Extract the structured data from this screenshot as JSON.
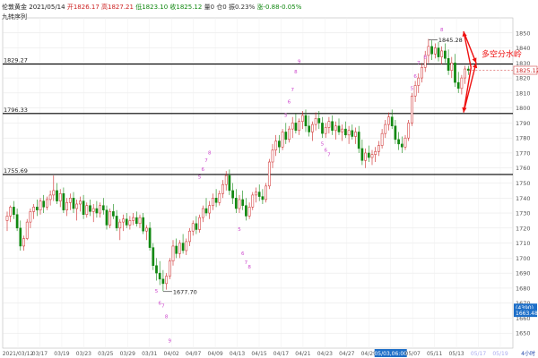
{
  "header": {
    "instrument": "伦敦黄金",
    "date": "2021/05/14",
    "open_label": "开",
    "open": "1826.17",
    "high_label": "高",
    "high": "1827.21",
    "low_label": "低",
    "low": "1823.10",
    "close_label": "收",
    "close": "1825.12",
    "volume_label": "量",
    "volume": "0",
    "oi_label": "仓",
    "oi": "0",
    "amplitude_label": "振",
    "amplitude": "0.23%",
    "change_label": "涨",
    "change": "-0.88",
    "change_pct": "-0.05%",
    "indicator": "九转序列"
  },
  "colors": {
    "up": "#cc2222",
    "down": "#118811",
    "level_line": "#000000",
    "grid": "#e3e3e3",
    "axis_text": "#555555",
    "td_up": "#cc44cc",
    "td_down": "#22aa22",
    "arrow": "#ee1111",
    "price_tag_bg": "#1e6fc8"
  },
  "chart_data": {
    "type": "candlestick",
    "title": "伦敦黄金 2021/05/14",
    "ylim": [
      1640,
      1860
    ],
    "y_ticks": [
      1650,
      1660,
      1670,
      1680,
      1690,
      1700,
      1710,
      1720,
      1730,
      1740,
      1750,
      1760,
      1770,
      1780,
      1790,
      1800,
      1810,
      1820,
      1830,
      1840,
      1850
    ],
    "x_ticks": [
      "2021/03/12",
      "03/17",
      "03/19",
      "03/23",
      "03/25",
      "03/29",
      "03/31",
      "04/02",
      "04/07",
      "04/09",
      "04/13",
      "04/15",
      "04/17",
      "04/21",
      "04/23",
      "04/27",
      "04/29",
      "05/03,06:00",
      "05/07",
      "05/11",
      "05/13",
      "05/17",
      "05/19"
    ],
    "x_ticks_future": [
      "05/17",
      "05/19"
    ],
    "x_tick_highlight": "05/03,06:00",
    "right_tags": [
      {
        "text": "(4390)",
        "value": 1667
      },
      {
        "text": "1663.48",
        "value": 1663.48
      }
    ],
    "level_lines": [
      {
        "value": 1829.27,
        "label": "1829.27"
      },
      {
        "value": 1796.33,
        "label": "1796.33"
      },
      {
        "value": 1755.69,
        "label": "1755.69"
      }
    ],
    "annotations": [
      {
        "text": "1845.28",
        "value": 1845.28,
        "kind": "high"
      },
      {
        "text": "1677.70",
        "value": 1677.7,
        "kind": "low"
      },
      {
        "text": "多空分水岭",
        "kind": "callout"
      }
    ],
    "current_price": "1825.12",
    "bottom_right_text": "4小时",
    "forecast": {
      "start": 1827,
      "up_target": 1851,
      "down_target": 1797,
      "ends": [
        1830,
        1830
      ]
    },
    "candles": [
      {
        "o": 1725,
        "h": 1731,
        "l": 1718,
        "c": 1728
      },
      {
        "o": 1728,
        "h": 1735,
        "l": 1724,
        "c": 1734
      },
      {
        "o": 1734,
        "h": 1738,
        "l": 1726,
        "c": 1729
      },
      {
        "o": 1729,
        "h": 1733,
        "l": 1718,
        "c": 1720
      },
      {
        "o": 1720,
        "h": 1725,
        "l": 1705,
        "c": 1708
      },
      {
        "o": 1708,
        "h": 1715,
        "l": 1705,
        "c": 1713
      },
      {
        "o": 1713,
        "h": 1726,
        "l": 1712,
        "c": 1724
      },
      {
        "o": 1724,
        "h": 1733,
        "l": 1720,
        "c": 1731
      },
      {
        "o": 1731,
        "h": 1736,
        "l": 1726,
        "c": 1734
      },
      {
        "o": 1734,
        "h": 1739,
        "l": 1728,
        "c": 1732
      },
      {
        "o": 1732,
        "h": 1740,
        "l": 1729,
        "c": 1738
      },
      {
        "o": 1738,
        "h": 1742,
        "l": 1730,
        "c": 1734
      },
      {
        "o": 1734,
        "h": 1741,
        "l": 1732,
        "c": 1739
      },
      {
        "o": 1739,
        "h": 1745,
        "l": 1735,
        "c": 1742
      },
      {
        "o": 1742,
        "h": 1755,
        "l": 1738,
        "c": 1745
      },
      {
        "o": 1745,
        "h": 1750,
        "l": 1736,
        "c": 1738
      },
      {
        "o": 1738,
        "h": 1746,
        "l": 1734,
        "c": 1743
      },
      {
        "o": 1743,
        "h": 1747,
        "l": 1730,
        "c": 1732
      },
      {
        "o": 1732,
        "h": 1740,
        "l": 1728,
        "c": 1737
      },
      {
        "o": 1737,
        "h": 1743,
        "l": 1732,
        "c": 1740
      },
      {
        "o": 1740,
        "h": 1744,
        "l": 1730,
        "c": 1733
      },
      {
        "o": 1733,
        "h": 1739,
        "l": 1725,
        "c": 1736
      },
      {
        "o": 1736,
        "h": 1741,
        "l": 1731,
        "c": 1738
      },
      {
        "o": 1738,
        "h": 1742,
        "l": 1726,
        "c": 1729
      },
      {
        "o": 1729,
        "h": 1737,
        "l": 1727,
        "c": 1735
      },
      {
        "o": 1735,
        "h": 1739,
        "l": 1728,
        "c": 1731
      },
      {
        "o": 1731,
        "h": 1736,
        "l": 1724,
        "c": 1733
      },
      {
        "o": 1733,
        "h": 1738,
        "l": 1727,
        "c": 1730
      },
      {
        "o": 1730,
        "h": 1737,
        "l": 1727,
        "c": 1735
      },
      {
        "o": 1735,
        "h": 1740,
        "l": 1729,
        "c": 1732
      },
      {
        "o": 1732,
        "h": 1735,
        "l": 1719,
        "c": 1722
      },
      {
        "o": 1722,
        "h": 1733,
        "l": 1720,
        "c": 1731
      },
      {
        "o": 1731,
        "h": 1736,
        "l": 1726,
        "c": 1728
      },
      {
        "o": 1728,
        "h": 1732,
        "l": 1718,
        "c": 1720
      },
      {
        "o": 1720,
        "h": 1726,
        "l": 1712,
        "c": 1724
      },
      {
        "o": 1724,
        "h": 1729,
        "l": 1718,
        "c": 1726
      },
      {
        "o": 1726,
        "h": 1730,
        "l": 1720,
        "c": 1722
      },
      {
        "o": 1722,
        "h": 1728,
        "l": 1719,
        "c": 1725
      },
      {
        "o": 1725,
        "h": 1730,
        "l": 1722,
        "c": 1727
      },
      {
        "o": 1727,
        "h": 1731,
        "l": 1721,
        "c": 1723
      },
      {
        "o": 1723,
        "h": 1729,
        "l": 1720,
        "c": 1727
      },
      {
        "o": 1727,
        "h": 1730,
        "l": 1716,
        "c": 1718
      },
      {
        "o": 1718,
        "h": 1722,
        "l": 1712,
        "c": 1720
      },
      {
        "o": 1720,
        "h": 1724,
        "l": 1705,
        "c": 1707
      },
      {
        "o": 1707,
        "h": 1710,
        "l": 1692,
        "c": 1695
      },
      {
        "o": 1695,
        "h": 1700,
        "l": 1685,
        "c": 1690
      },
      {
        "o": 1690,
        "h": 1698,
        "l": 1682,
        "c": 1686
      },
      {
        "o": 1686,
        "h": 1692,
        "l": 1678,
        "c": 1683
      },
      {
        "o": 1683,
        "h": 1690,
        "l": 1679,
        "c": 1688
      },
      {
        "o": 1688,
        "h": 1700,
        "l": 1686,
        "c": 1698
      },
      {
        "o": 1698,
        "h": 1712,
        "l": 1695,
        "c": 1708
      },
      {
        "o": 1708,
        "h": 1713,
        "l": 1700,
        "c": 1703
      },
      {
        "o": 1703,
        "h": 1712,
        "l": 1700,
        "c": 1710
      },
      {
        "o": 1710,
        "h": 1716,
        "l": 1703,
        "c": 1705
      },
      {
        "o": 1705,
        "h": 1713,
        "l": 1702,
        "c": 1711
      },
      {
        "o": 1711,
        "h": 1720,
        "l": 1708,
        "c": 1718
      },
      {
        "o": 1718,
        "h": 1725,
        "l": 1715,
        "c": 1723
      },
      {
        "o": 1723,
        "h": 1728,
        "l": 1716,
        "c": 1719
      },
      {
        "o": 1719,
        "h": 1729,
        "l": 1717,
        "c": 1727
      },
      {
        "o": 1727,
        "h": 1735,
        "l": 1724,
        "c": 1733
      },
      {
        "o": 1733,
        "h": 1740,
        "l": 1728,
        "c": 1730
      },
      {
        "o": 1730,
        "h": 1738,
        "l": 1726,
        "c": 1735
      },
      {
        "o": 1735,
        "h": 1743,
        "l": 1732,
        "c": 1740
      },
      {
        "o": 1740,
        "h": 1746,
        "l": 1734,
        "c": 1737
      },
      {
        "o": 1737,
        "h": 1745,
        "l": 1735,
        "c": 1743
      },
      {
        "o": 1743,
        "h": 1752,
        "l": 1740,
        "c": 1749
      },
      {
        "o": 1749,
        "h": 1758,
        "l": 1745,
        "c": 1755
      },
      {
        "o": 1755,
        "h": 1759,
        "l": 1742,
        "c": 1745
      },
      {
        "o": 1745,
        "h": 1750,
        "l": 1736,
        "c": 1740
      },
      {
        "o": 1740,
        "h": 1746,
        "l": 1730,
        "c": 1733
      },
      {
        "o": 1733,
        "h": 1742,
        "l": 1730,
        "c": 1739
      },
      {
        "o": 1739,
        "h": 1745,
        "l": 1732,
        "c": 1735
      },
      {
        "o": 1735,
        "h": 1740,
        "l": 1725,
        "c": 1728
      },
      {
        "o": 1728,
        "h": 1737,
        "l": 1726,
        "c": 1734
      },
      {
        "o": 1734,
        "h": 1744,
        "l": 1732,
        "c": 1742
      },
      {
        "o": 1742,
        "h": 1747,
        "l": 1737,
        "c": 1744
      },
      {
        "o": 1744,
        "h": 1749,
        "l": 1738,
        "c": 1741
      },
      {
        "o": 1741,
        "h": 1746,
        "l": 1736,
        "c": 1739
      },
      {
        "o": 1739,
        "h": 1750,
        "l": 1737,
        "c": 1748
      },
      {
        "o": 1748,
        "h": 1766,
        "l": 1746,
        "c": 1764
      },
      {
        "o": 1764,
        "h": 1776,
        "l": 1760,
        "c": 1772
      },
      {
        "o": 1772,
        "h": 1782,
        "l": 1768,
        "c": 1778
      },
      {
        "o": 1778,
        "h": 1782,
        "l": 1770,
        "c": 1774
      },
      {
        "o": 1774,
        "h": 1786,
        "l": 1772,
        "c": 1784
      },
      {
        "o": 1784,
        "h": 1790,
        "l": 1776,
        "c": 1779
      },
      {
        "o": 1779,
        "h": 1788,
        "l": 1777,
        "c": 1786
      },
      {
        "o": 1786,
        "h": 1794,
        "l": 1780,
        "c": 1790
      },
      {
        "o": 1790,
        "h": 1796,
        "l": 1783,
        "c": 1785
      },
      {
        "o": 1785,
        "h": 1793,
        "l": 1782,
        "c": 1791
      },
      {
        "o": 1791,
        "h": 1798,
        "l": 1786,
        "c": 1795
      },
      {
        "o": 1795,
        "h": 1799,
        "l": 1784,
        "c": 1788
      },
      {
        "o": 1788,
        "h": 1795,
        "l": 1781,
        "c": 1784
      },
      {
        "o": 1784,
        "h": 1791,
        "l": 1778,
        "c": 1789
      },
      {
        "o": 1789,
        "h": 1797,
        "l": 1785,
        "c": 1793
      },
      {
        "o": 1793,
        "h": 1798,
        "l": 1786,
        "c": 1790
      },
      {
        "o": 1790,
        "h": 1794,
        "l": 1780,
        "c": 1783
      },
      {
        "o": 1783,
        "h": 1790,
        "l": 1780,
        "c": 1787
      },
      {
        "o": 1787,
        "h": 1794,
        "l": 1783,
        "c": 1791
      },
      {
        "o": 1791,
        "h": 1795,
        "l": 1782,
        "c": 1785
      },
      {
        "o": 1785,
        "h": 1791,
        "l": 1779,
        "c": 1788
      },
      {
        "o": 1788,
        "h": 1793,
        "l": 1782,
        "c": 1784
      },
      {
        "o": 1784,
        "h": 1789,
        "l": 1778,
        "c": 1786
      },
      {
        "o": 1786,
        "h": 1791,
        "l": 1780,
        "c": 1782
      },
      {
        "o": 1782,
        "h": 1788,
        "l": 1776,
        "c": 1785
      },
      {
        "o": 1785,
        "h": 1789,
        "l": 1779,
        "c": 1781
      },
      {
        "o": 1781,
        "h": 1787,
        "l": 1776,
        "c": 1784
      },
      {
        "o": 1784,
        "h": 1788,
        "l": 1770,
        "c": 1773
      },
      {
        "o": 1773,
        "h": 1779,
        "l": 1762,
        "c": 1765
      },
      {
        "o": 1765,
        "h": 1773,
        "l": 1760,
        "c": 1770
      },
      {
        "o": 1770,
        "h": 1775,
        "l": 1764,
        "c": 1767
      },
      {
        "o": 1767,
        "h": 1772,
        "l": 1762,
        "c": 1769
      },
      {
        "o": 1769,
        "h": 1774,
        "l": 1764,
        "c": 1771
      },
      {
        "o": 1771,
        "h": 1778,
        "l": 1768,
        "c": 1775
      },
      {
        "o": 1775,
        "h": 1786,
        "l": 1773,
        "c": 1783
      },
      {
        "o": 1783,
        "h": 1792,
        "l": 1780,
        "c": 1789
      },
      {
        "o": 1789,
        "h": 1797,
        "l": 1785,
        "c": 1794
      },
      {
        "o": 1794,
        "h": 1799,
        "l": 1786,
        "c": 1788
      },
      {
        "o": 1788,
        "h": 1792,
        "l": 1776,
        "c": 1779
      },
      {
        "o": 1779,
        "h": 1784,
        "l": 1772,
        "c": 1776
      },
      {
        "o": 1776,
        "h": 1781,
        "l": 1770,
        "c": 1774
      },
      {
        "o": 1774,
        "h": 1782,
        "l": 1772,
        "c": 1780
      },
      {
        "o": 1780,
        "h": 1792,
        "l": 1778,
        "c": 1790
      },
      {
        "o": 1790,
        "h": 1810,
        "l": 1788,
        "c": 1808
      },
      {
        "o": 1808,
        "h": 1818,
        "l": 1804,
        "c": 1815
      },
      {
        "o": 1815,
        "h": 1823,
        "l": 1810,
        "c": 1820
      },
      {
        "o": 1820,
        "h": 1830,
        "l": 1817,
        "c": 1827
      },
      {
        "o": 1827,
        "h": 1838,
        "l": 1824,
        "c": 1835
      },
      {
        "o": 1835,
        "h": 1846,
        "l": 1830,
        "c": 1841
      },
      {
        "o": 1841,
        "h": 1845,
        "l": 1832,
        "c": 1836
      },
      {
        "o": 1836,
        "h": 1843,
        "l": 1833,
        "c": 1840
      },
      {
        "o": 1840,
        "h": 1844,
        "l": 1831,
        "c": 1834
      },
      {
        "o": 1834,
        "h": 1841,
        "l": 1829,
        "c": 1838
      },
      {
        "o": 1838,
        "h": 1843,
        "l": 1830,
        "c": 1833
      },
      {
        "o": 1833,
        "h": 1839,
        "l": 1822,
        "c": 1825
      },
      {
        "o": 1825,
        "h": 1834,
        "l": 1820,
        "c": 1830
      },
      {
        "o": 1830,
        "h": 1836,
        "l": 1814,
        "c": 1817
      },
      {
        "o": 1817,
        "h": 1824,
        "l": 1810,
        "c": 1813
      },
      {
        "o": 1813,
        "h": 1822,
        "l": 1809,
        "c": 1820
      },
      {
        "o": 1820,
        "h": 1828,
        "l": 1816,
        "c": 1826
      },
      {
        "o": 1826,
        "h": 1828,
        "l": 1822,
        "c": 1825
      }
    ],
    "td_labels_up": [
      {
        "i": 58,
        "text": "5",
        "v": 1753
      },
      {
        "i": 59,
        "text": "6",
        "v": 1758
      },
      {
        "i": 60,
        "text": "7",
        "v": 1764
      },
      {
        "i": 61,
        "text": "8",
        "v": 1769
      },
      {
        "i": 84,
        "text": "5",
        "v": 1794
      },
      {
        "i": 85,
        "text": "6",
        "v": 1803
      },
      {
        "i": 86,
        "text": "7",
        "v": 1811
      },
      {
        "i": 87,
        "text": "8",
        "v": 1823
      },
      {
        "i": 88,
        "text": "9",
        "v": 1830
      },
      {
        "i": 122,
        "text": "5",
        "v": 1812
      },
      {
        "i": 123,
        "text": "6",
        "v": 1820
      },
      {
        "i": 124,
        "text": "7",
        "v": 1829
      },
      {
        "i": 126,
        "text": "8",
        "v": 1833
      },
      {
        "i": 131,
        "text": "8",
        "v": 1851
      }
    ],
    "td_labels_down": [
      {
        "i": 45,
        "text": "5",
        "v": 1677
      },
      {
        "i": 46,
        "text": "6",
        "v": 1669
      },
      {
        "i": 47,
        "text": "7",
        "v": 1667
      },
      {
        "i": 48,
        "text": "8",
        "v": 1660
      },
      {
        "i": 49,
        "text": "9",
        "v": 1644
      },
      {
        "i": 70,
        "text": "5",
        "v": 1718
      },
      {
        "i": 71,
        "text": "6",
        "v": 1702
      },
      {
        "i": 72,
        "text": "7",
        "v": 1696
      },
      {
        "i": 73,
        "text": "8",
        "v": 1693
      },
      {
        "i": 95,
        "text": "5",
        "v": 1775
      },
      {
        "i": 96,
        "text": "6",
        "v": 1771
      },
      {
        "i": 97,
        "text": "7",
        "v": 1768
      }
    ]
  }
}
